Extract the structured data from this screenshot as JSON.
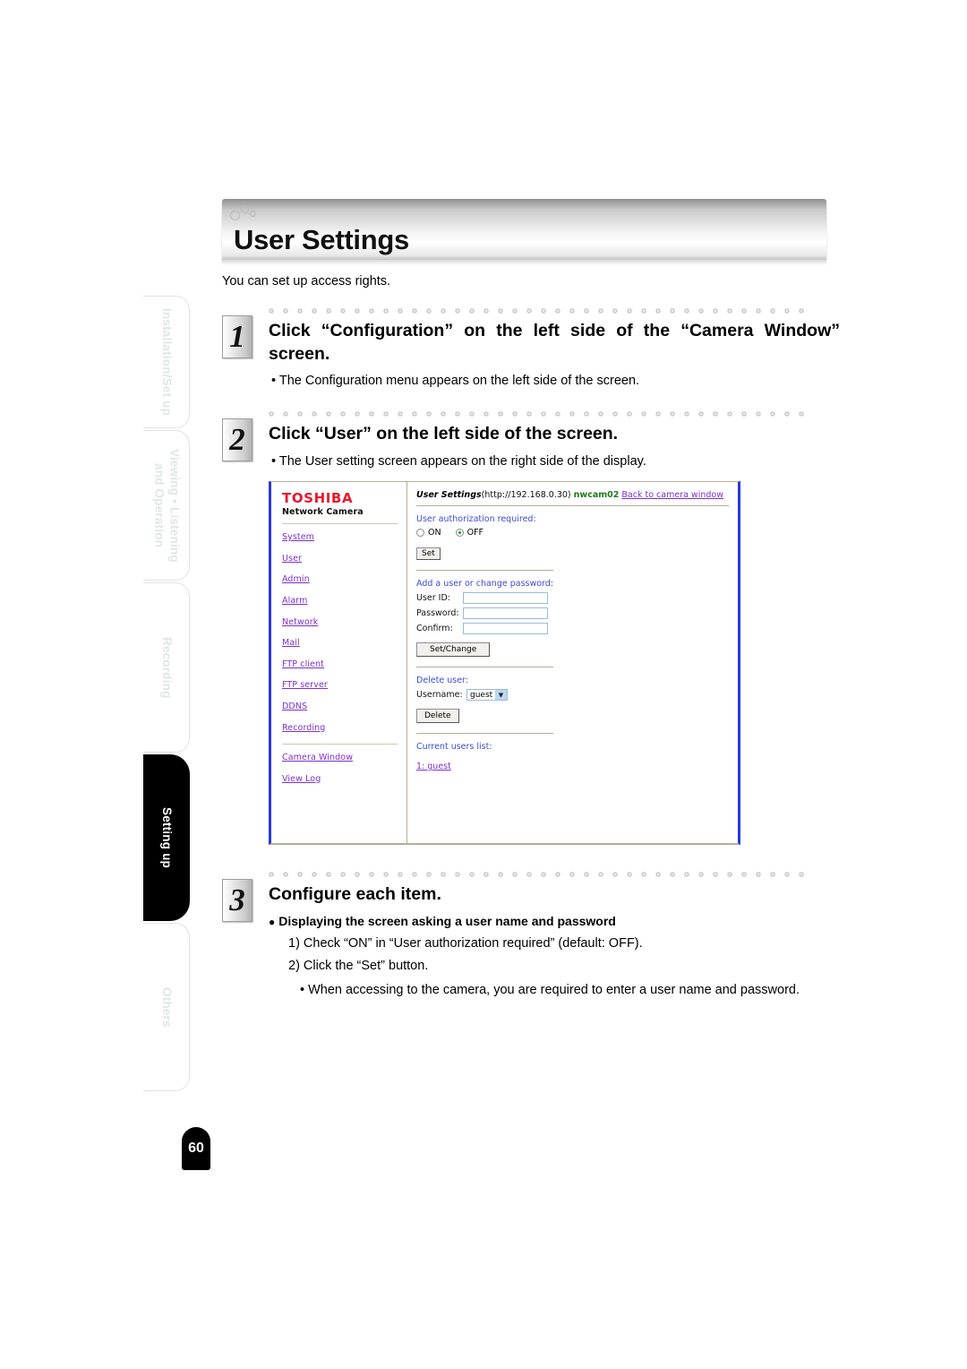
{
  "page": {
    "number": "60"
  },
  "sidebar": {
    "tabs": [
      {
        "label": "Installation/Set up",
        "active": false
      },
      {
        "label": "Viewing • Listening\nand Operation",
        "active": false
      },
      {
        "label": "Recording",
        "active": false
      },
      {
        "label": "Setting up",
        "active": true
      },
      {
        "label": "Others",
        "active": false
      }
    ]
  },
  "banner": {
    "title": "User Settings"
  },
  "intro": "You can set up access rights.",
  "steps": [
    {
      "number": "1",
      "title": "Click “Configuration” on the left side of the “Camera Window” screen.",
      "note": "• The Configuration menu appears on the left side of the screen."
    },
    {
      "number": "2",
      "title": "Click “User” on the left side of the screen.",
      "note": "• The User setting screen appears on the right side of the display."
    },
    {
      "number": "3",
      "title": "Configure each item."
    }
  ],
  "screenshot": {
    "brand_primary": "TOSHIBA",
    "brand_secondary": "Network Camera",
    "nav_links": [
      "System",
      "User",
      "Admin",
      "Alarm",
      "Network",
      "Mail",
      "FTP client",
      "FTP server",
      "DDNS",
      "Recording"
    ],
    "nav_links_bottom": [
      "Camera Window",
      "View Log"
    ],
    "header": {
      "title": "User Settings",
      "url": "(http://192.168.0.30)",
      "camera": "nwcam02",
      "back_link": "Back to camera window"
    },
    "auth": {
      "label": "User authorization required:",
      "option_on": "ON",
      "option_off": "OFF",
      "selected": "OFF",
      "set_button": "Set"
    },
    "add_user": {
      "label": "Add a user or change password:",
      "user_id_label": "User ID:",
      "user_id_value": "",
      "password_label": "Password:",
      "password_value": "",
      "confirm_label": "Confirm:",
      "confirm_value": "",
      "button": "Set/Change"
    },
    "delete_user": {
      "label": "Delete user:",
      "username_label": "Username:",
      "username_value": "guest",
      "options": [
        "guest"
      ],
      "button": "Delete"
    },
    "current_users": {
      "label": "Current users list:",
      "entries": [
        "1: guest"
      ]
    }
  },
  "step3": {
    "sub_heading": "Displaying the screen asking a user name and password",
    "item1": "1) Check “ON” in “User authorization required” (default: OFF).",
    "item2": "2) Click the “Set” button.",
    "bullet": "• When accessing to the camera, you are required to enter a user name and password."
  }
}
